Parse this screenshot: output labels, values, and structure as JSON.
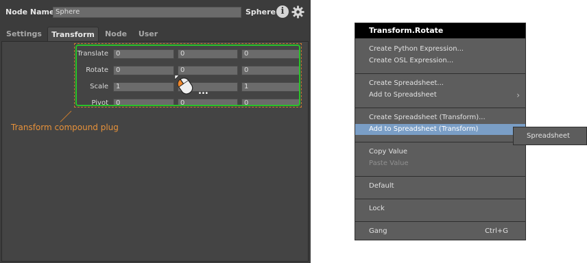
{
  "header": {
    "node_name_label": "Node Name",
    "node_name_value": "Sphere",
    "node_type": "Sphere",
    "info_icon": "info-icon",
    "settings_icon": "gear-icon"
  },
  "tabs": [
    {
      "label": "Settings",
      "active": false
    },
    {
      "label": "Transform",
      "active": true
    },
    {
      "label": "Node",
      "active": false
    },
    {
      "label": "User",
      "active": false
    }
  ],
  "transform": {
    "rows": [
      {
        "label": "Translate",
        "values": [
          "0",
          "0",
          "0"
        ]
      },
      {
        "label": "Rotate",
        "values": [
          "0",
          "0",
          "0"
        ]
      },
      {
        "label": "Scale",
        "values": [
          "1",
          "1",
          "1"
        ]
      },
      {
        "label": "Pivot",
        "values": [
          "0",
          "0",
          "0"
        ]
      }
    ]
  },
  "annotation": {
    "text": "Transform compound plug",
    "color": "#e8923a",
    "highlight_color": "#29c229"
  },
  "cursor": {
    "icon": "mouse-icon",
    "ellipsis": "..."
  },
  "menu": {
    "title": "Transform.Rotate",
    "items": [
      {
        "label": "Create Python Expression...",
        "enabled": true
      },
      {
        "label": "Create OSL Expression...",
        "enabled": true
      },
      {
        "label": "Create Spreadsheet...",
        "enabled": true
      },
      {
        "label": "Add to Spreadsheet",
        "enabled": true,
        "submenu": true
      },
      {
        "label": "Create Spreadsheet (Transform)...",
        "enabled": true
      },
      {
        "label": "Add to Spreadsheet (Transform)",
        "enabled": true,
        "submenu": true,
        "selected": true
      },
      {
        "label": "Copy Value",
        "enabled": true
      },
      {
        "label": "Paste Value",
        "enabled": false
      },
      {
        "label": "Default",
        "enabled": true
      },
      {
        "label": "Lock",
        "enabled": true
      },
      {
        "label": "Gang",
        "enabled": true,
        "shortcut": "Ctrl+G"
      }
    ],
    "selected_color": "#7a9ec6"
  },
  "submenu": {
    "items": [
      {
        "label": "Spreadsheet"
      }
    ]
  }
}
